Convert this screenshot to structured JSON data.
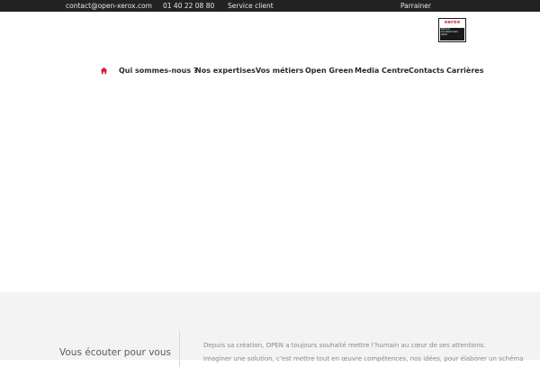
{
  "topbar": {
    "email": "contact@open-xerox.com",
    "phone": "01 40 22 08 80",
    "service_client": "Service client",
    "parrainer": "Parrainer"
  },
  "badge": {
    "logo_text": "xerox",
    "line1": "Platinum",
    "line2": "Concessionnaire",
    "line3": "Agréé"
  },
  "nav": {
    "home_icon": "home-icon",
    "items": [
      "Qui sommes-nous ?",
      "Nos expertises",
      "Vos métiers",
      "Open Green",
      "Media Centre",
      "Contacts",
      "Carrières"
    ]
  },
  "lower": {
    "heading": "Vous écouter pour vous",
    "paragraph1": "Depuis sa création, OPEN a toujours souhaité mettre l’humain au cœur de ses attentions.",
    "paragraph2": "Imaginer une solution, c’est mettre tout en œuvre compétences, nos idées, pour élaborer un schéma"
  },
  "colors": {
    "topbar_bg": "#222222",
    "home_icon": "#d11f2f",
    "nav_text": "#2a2a2a",
    "lower_bg": "#f3f3f3"
  }
}
